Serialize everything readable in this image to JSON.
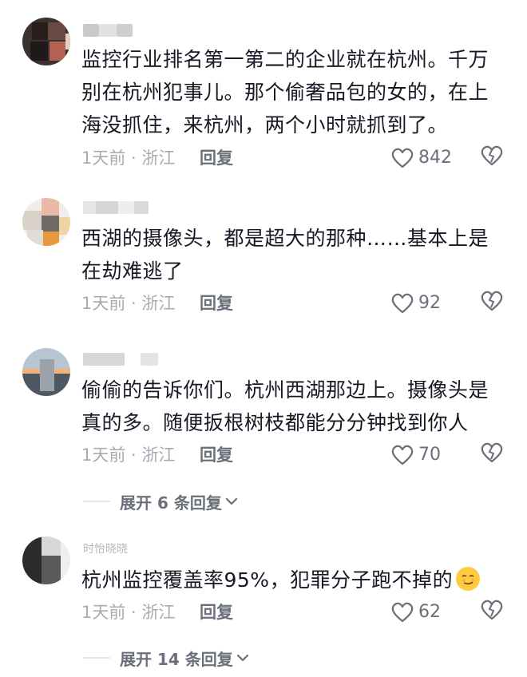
{
  "comments": [
    {
      "text": "监控行业排名第一第二的企业就在杭州。千万别在杭州犯事儿。那个偷奢品包的女的，在上海没抓住，来杭州，两个小时就抓到了。",
      "time_location": "1天前 · 浙江",
      "reply_label": "回复",
      "likes": "842"
    },
    {
      "text": "西湖的摄像头，都是超大的那种……基本上是在劫难逃了",
      "time_location": "1天前 · 浙江",
      "reply_label": "回复",
      "likes": "92"
    },
    {
      "text": "偷偷的告诉你们。杭州西湖那边上。摄像头是真的多。随便扳根树枝都能分分钟找到你人",
      "time_location": "1天前 · 浙江",
      "reply_label": "回复",
      "likes": "70"
    },
    {
      "username": "时怡晓晓",
      "text": "杭州监控覆盖率95%，犯罪分子跑不掉的",
      "emoji": "smirk-emoji",
      "time_location": "1天前 · 浙江",
      "reply_label": "回复",
      "likes": "62"
    }
  ],
  "expand_replies": [
    {
      "label": "展开 6 条回复"
    },
    {
      "label": "展开 14 条回复"
    }
  ],
  "colors": {
    "text": "#161823",
    "meta": "#a8abb2",
    "accent_gray": "#6b6f7a",
    "emoji": "#ffcc3d"
  }
}
